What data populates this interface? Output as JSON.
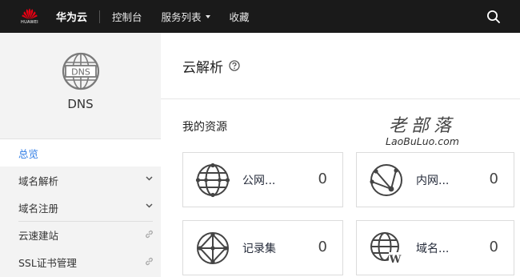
{
  "topbar": {
    "logo_word": "HUAWEI",
    "brand": "华为云",
    "nav": [
      {
        "label": "控制台"
      },
      {
        "label": "服务列表"
      },
      {
        "label": "收藏"
      }
    ],
    "search_icon": "search-icon"
  },
  "sidebar": {
    "logo_text": "DNS",
    "title": "DNS",
    "items": [
      {
        "label": "总览",
        "active": true
      },
      {
        "label": "域名解析",
        "icon": "chevron-down-icon"
      },
      {
        "label": "域名注册",
        "icon": "chevron-down-icon"
      },
      {
        "label": "云速建站",
        "icon": "link-icon"
      },
      {
        "label": "SSL证书管理",
        "icon": "link-icon"
      }
    ]
  },
  "main": {
    "title": "云解析",
    "help_icon": "help-icon",
    "section_title": "我的资源",
    "cards": [
      {
        "label": "公网...",
        "count": "0",
        "icon": "public-network-icon"
      },
      {
        "label": "内网...",
        "count": "0",
        "icon": "private-network-icon"
      },
      {
        "label": "记录集",
        "count": "0",
        "icon": "record-set-icon"
      },
      {
        "label": "域名...",
        "count": "0",
        "icon": "domain-www-icon"
      }
    ]
  },
  "watermark": {
    "line1": "老部落",
    "line2": "LaoBuLuo.com"
  },
  "colors": {
    "topbar_bg": "#1a1a1a",
    "accent": "#2c7be5",
    "huawei_red": "#e60012"
  }
}
